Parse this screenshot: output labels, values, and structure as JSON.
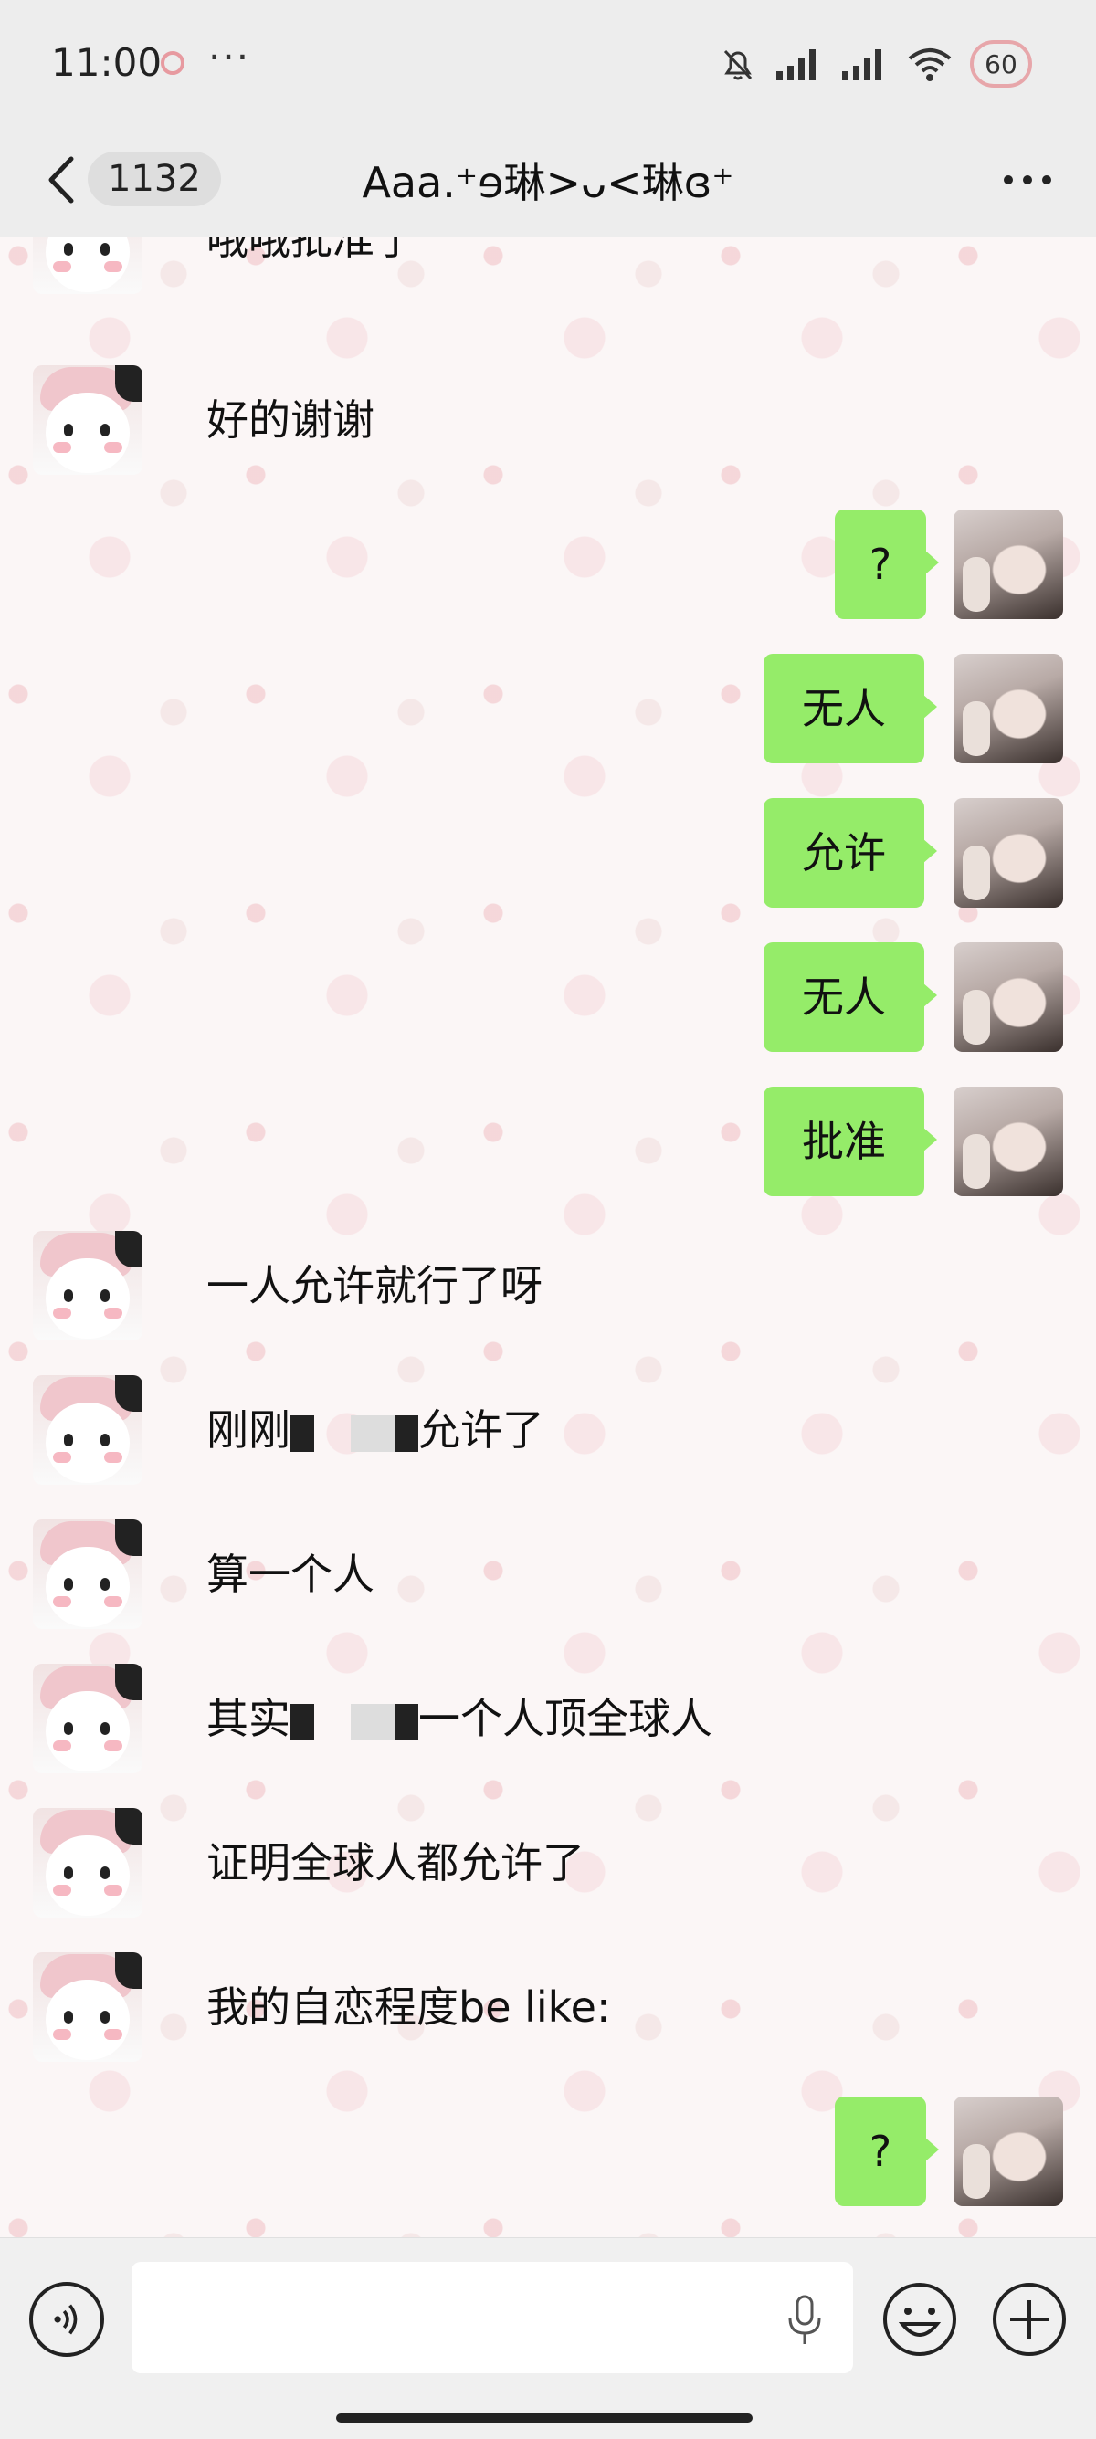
{
  "status_bar": {
    "time": "11:00",
    "dots": "···",
    "battery": "60"
  },
  "nav": {
    "unread_count": "1132",
    "title": "Aaa.⁺ɘ琳>ᴗ<琳ɞ⁺"
  },
  "messages": [
    {
      "side": "left",
      "text": "哦哦批准了"
    },
    {
      "side": "left",
      "text": "好的谢谢"
    },
    {
      "side": "right",
      "text": "?"
    },
    {
      "side": "right",
      "text": "无人"
    },
    {
      "side": "right",
      "text": "允许"
    },
    {
      "side": "right",
      "text": "无人"
    },
    {
      "side": "right",
      "text": "批准"
    },
    {
      "side": "left",
      "text": "一人允许就行了呀"
    },
    {
      "side": "left",
      "text_before": "刚刚",
      "text_after": "允许了"
    },
    {
      "side": "left",
      "text": "算一个人"
    },
    {
      "side": "left",
      "text_before": "其实",
      "text_after": "一个人顶全球人"
    },
    {
      "side": "left",
      "text": "证明全球人都允许了"
    },
    {
      "side": "left",
      "text": "我的自恋程度be like:"
    },
    {
      "side": "right",
      "text": "?"
    }
  ],
  "input": {
    "value": "",
    "placeholder": ""
  },
  "icons": {
    "back": "chevron-left-icon",
    "more": "more-horizontal-icon",
    "voice": "voice-icon",
    "mic": "microphone-icon",
    "emoji": "emoji-icon",
    "plus": "plus-icon"
  }
}
